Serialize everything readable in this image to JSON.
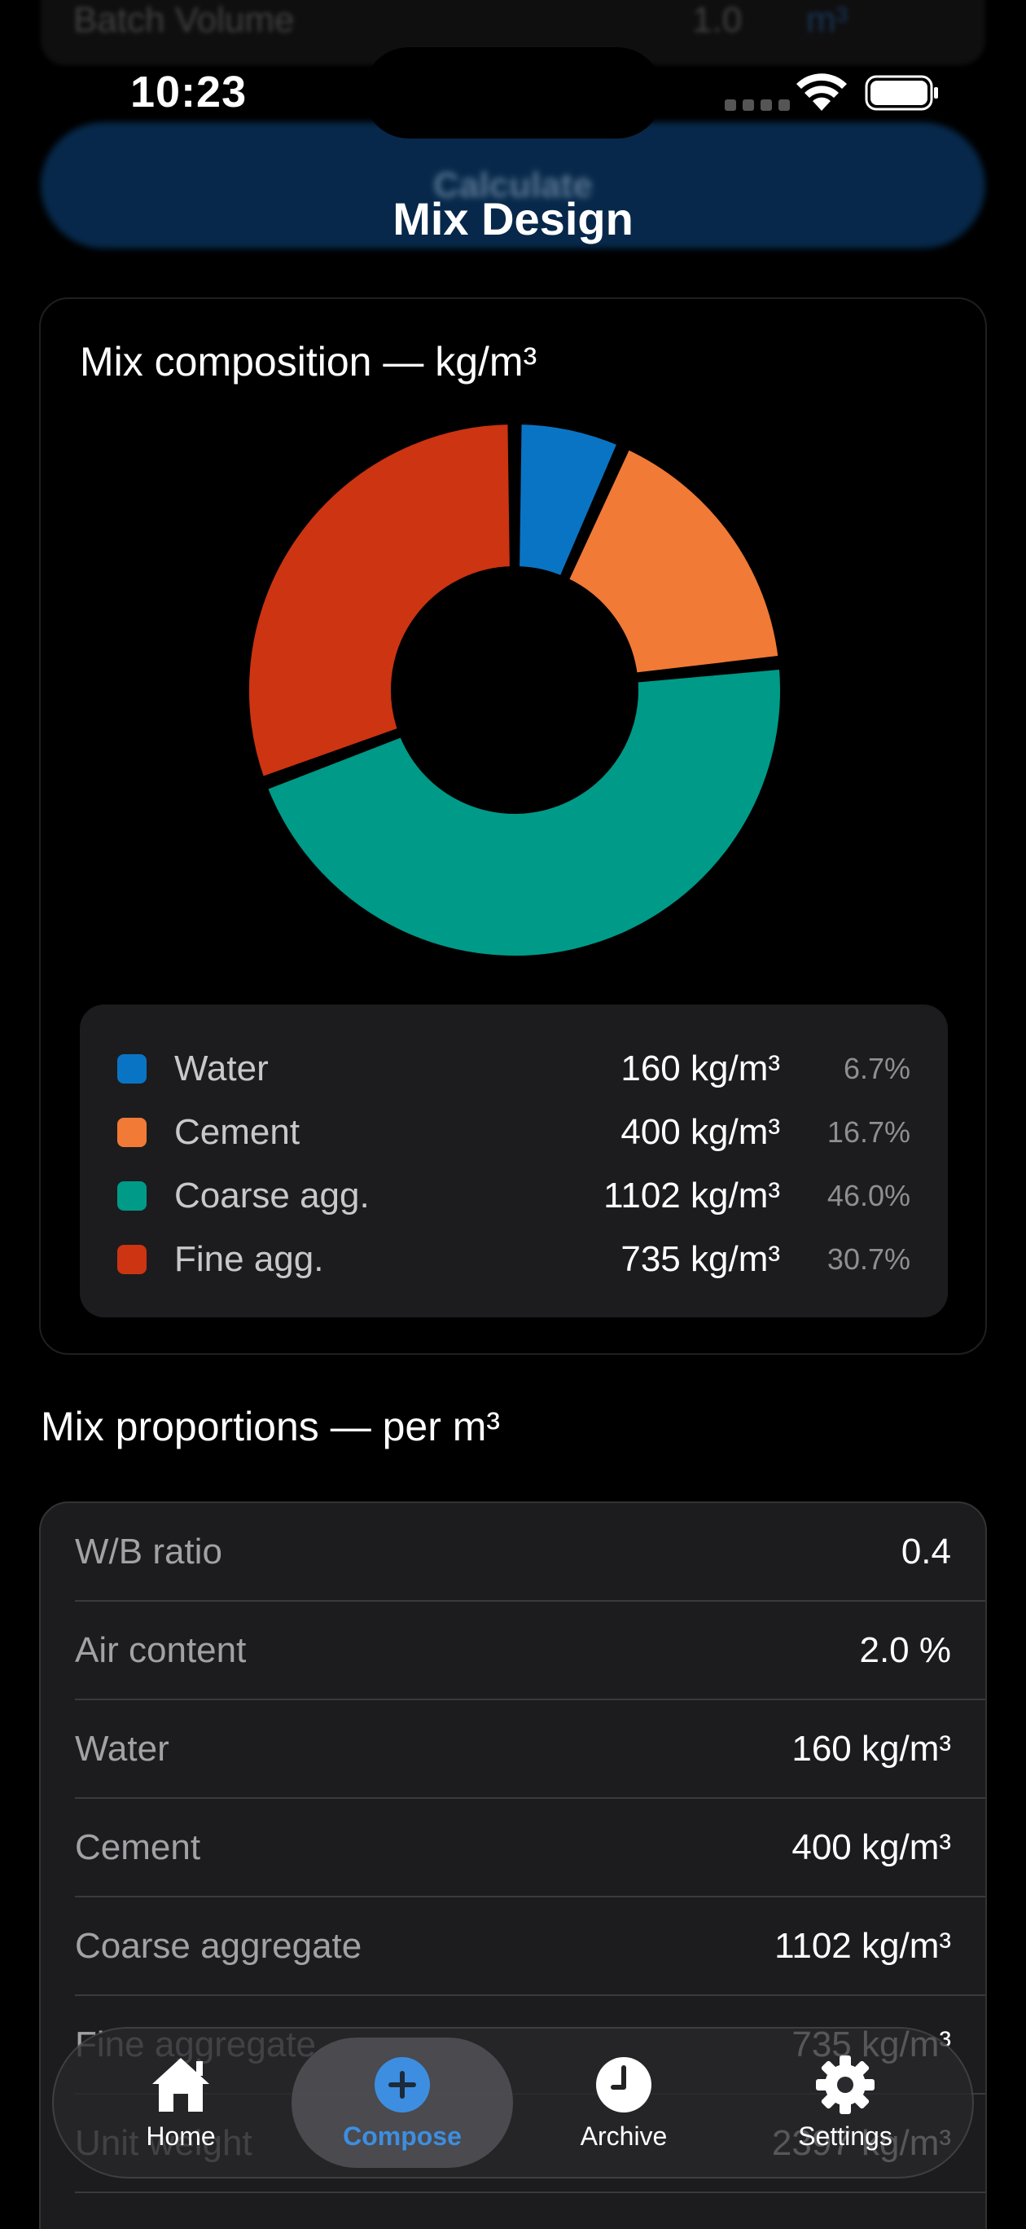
{
  "scrolled_under": {
    "row_label": "Batch Volume",
    "row_value": "1.0",
    "row_unit": "m³",
    "calculate_label": "Calculate"
  },
  "status_bar": {
    "time": "10:23"
  },
  "nav": {
    "title": "Mix Design"
  },
  "chart": {
    "title": "Mix composition — kg/m³"
  },
  "chart_data": {
    "type": "pie",
    "donut": true,
    "title": "Mix composition — kg/m³",
    "categories": [
      "Water",
      "Cement",
      "Coarse agg.",
      "Fine agg."
    ],
    "values": [
      160,
      400,
      1102,
      735
    ],
    "value_labels": [
      "160 kg/m³",
      "400 kg/m³",
      "1102 kg/m³",
      "735 kg/m³"
    ],
    "percent_labels": [
      "6.7%",
      "16.7%",
      "46.0%",
      "30.7%"
    ],
    "colors": [
      "#0a74c4",
      "#f07a36",
      "#009a88",
      "#cc3412"
    ],
    "legend": "below"
  },
  "proportions": {
    "title": "Mix proportions — per m³",
    "rows": [
      {
        "label": "W/B ratio",
        "value": "0.4"
      },
      {
        "label": "Air content",
        "value": "2.0 %"
      },
      {
        "label": "Water",
        "value": "160 kg/m³"
      },
      {
        "label": "Cement",
        "value": "400 kg/m³"
      },
      {
        "label": "Coarse aggregate",
        "value": "1102 kg/m³"
      },
      {
        "label": "Fine aggregate",
        "value": "735 kg/m³"
      },
      {
        "label": "Unit weight",
        "value": "2397 kg/m³"
      }
    ]
  },
  "tabbar": {
    "tabs": [
      {
        "label": "Home",
        "icon": "house-icon"
      },
      {
        "label": "Compose",
        "icon": "plus-circle-icon",
        "active": true
      },
      {
        "label": "Archive",
        "icon": "clock-icon"
      },
      {
        "label": "Settings",
        "icon": "gear-icon"
      }
    ]
  }
}
